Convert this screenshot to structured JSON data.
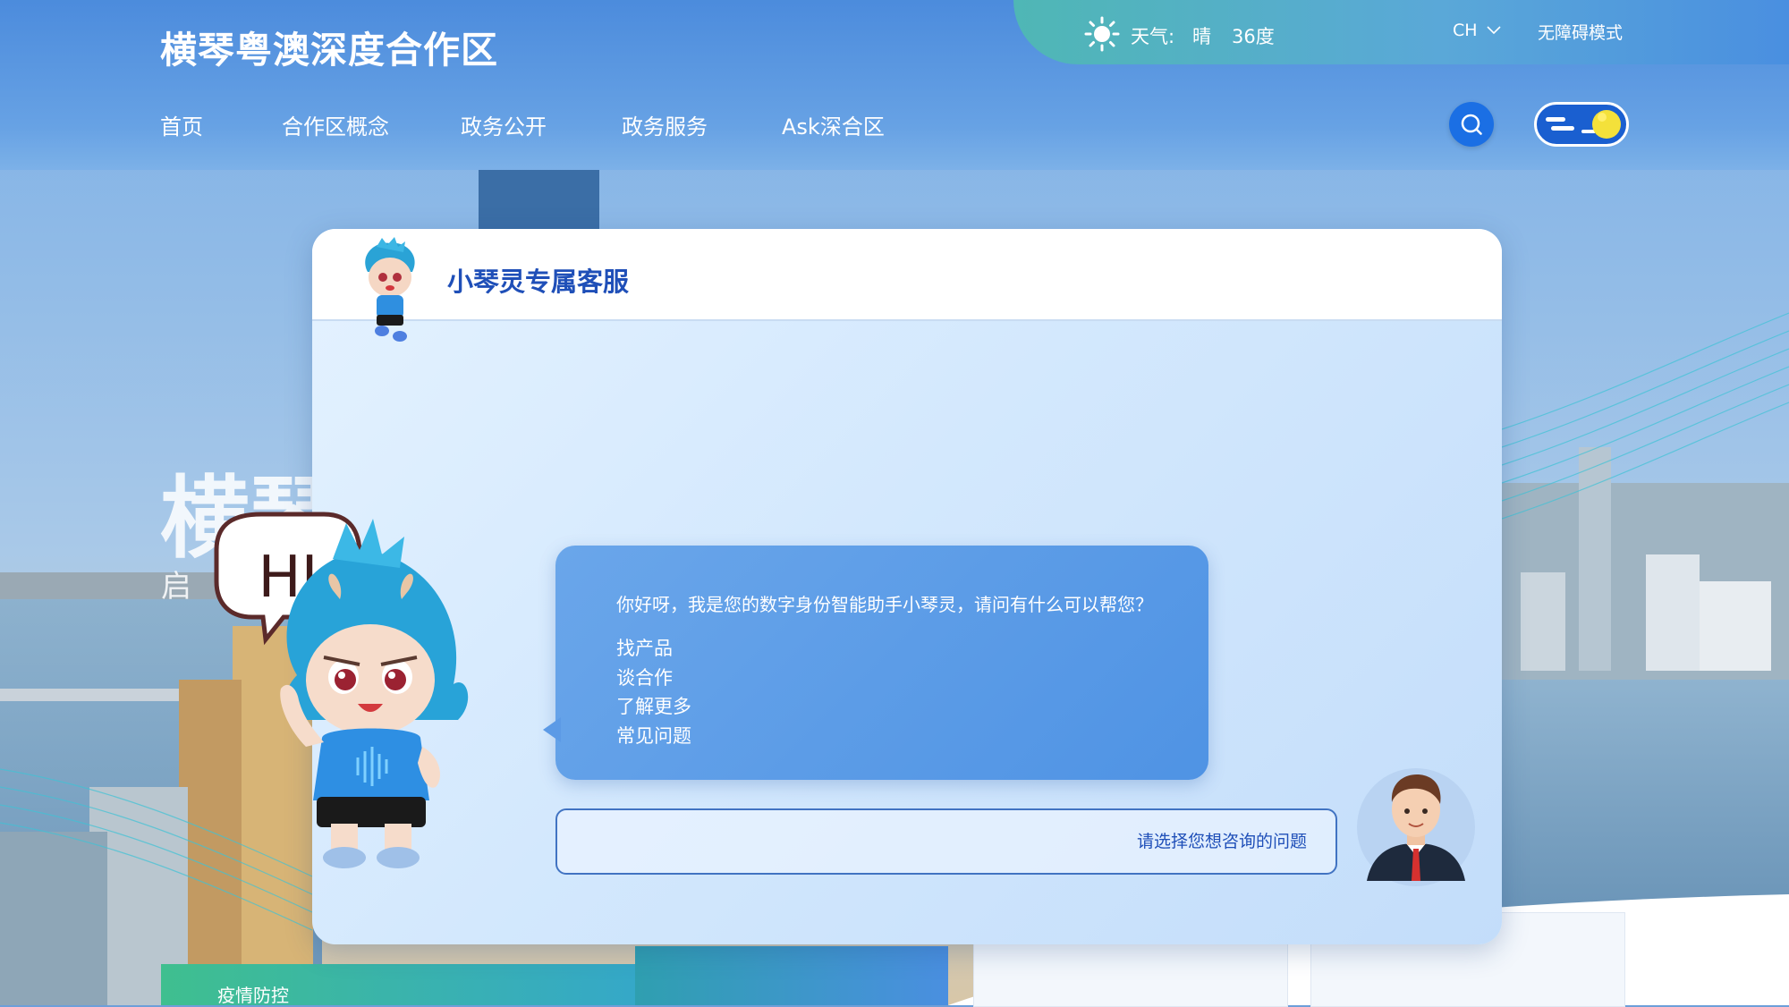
{
  "header": {
    "site_title": "横琴粤澳深度合作区",
    "weather_label": "天气:",
    "weather_value": "晴",
    "temperature": "36度",
    "language": "CH",
    "accessibility_mode": "无障碍模式"
  },
  "nav": {
    "items": [
      {
        "label": "首页"
      },
      {
        "label": "合作区概念"
      },
      {
        "label": "政务公开"
      },
      {
        "label": "政务服务"
      },
      {
        "label": "Ask深合区"
      }
    ]
  },
  "hero": {
    "big_text": "横琴",
    "sub_text": "启"
  },
  "mascot": {
    "greeting_badge": "HI"
  },
  "chat": {
    "title": "小琴灵专属客服",
    "greeting": "你好呀，我是您的数字身份智能助手小琴灵，请问有什么可以帮您？",
    "options": [
      "找产品",
      "谈合作",
      "了解更多",
      "常见问题"
    ],
    "input_placeholder": "请选择您想咨询的问题"
  },
  "bottom": {
    "epidemic_label": "疫情防控"
  },
  "colors": {
    "brand_blue": "#1f4fb8",
    "header_blue": "#4a8adc",
    "bubble_blue": "#5a9ae6",
    "search_button": "#1b6fe4",
    "weather_teal": "#4fb7b5"
  },
  "icons": [
    "sun-icon",
    "chevron-down-icon",
    "search-icon",
    "theme-toggle-icon",
    "mascot-icon",
    "agent-avatar-icon"
  ]
}
